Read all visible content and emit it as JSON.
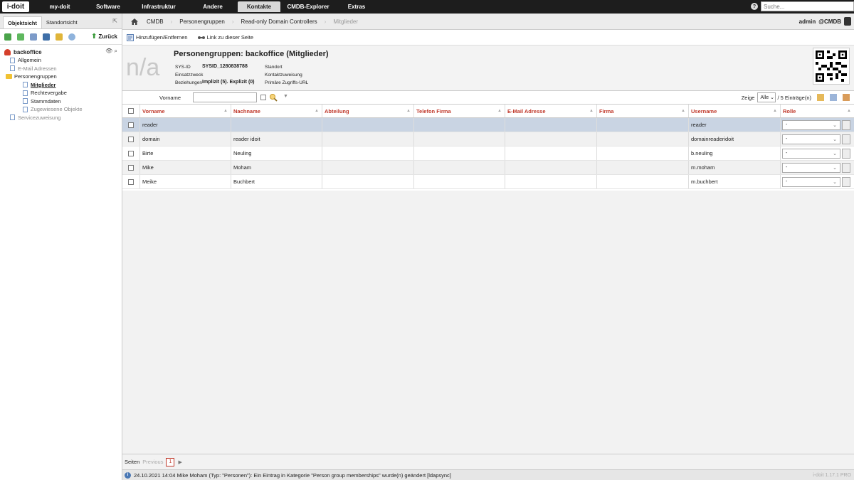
{
  "app": {
    "logo": "i-doit"
  },
  "nav": {
    "items": [
      "my-doit",
      "Software",
      "Infrastruktur",
      "Andere",
      "Kontakte",
      "CMDB-Explorer",
      "Extras"
    ],
    "active": "Kontakte"
  },
  "search": {
    "placeholder": "Suche..."
  },
  "left_panel": {
    "tabs": [
      "Objektsicht",
      "Standortsicht"
    ],
    "back_label": "Zurück",
    "root": "backoffice",
    "tree": [
      "Allgemein",
      "E-Mail Adressen",
      "Personengruppen",
      "Mitglieder",
      "Rechtevergabe",
      "Stammdaten",
      "Zugewiesene Objekte",
      "Servicezuweisung"
    ]
  },
  "breadcrumb": [
    "CMDB",
    "Personengruppen",
    "Read-only Domain Controllers",
    "Mitglieder"
  ],
  "user": {
    "name": "admin",
    "tenant": "@CMDB"
  },
  "actions": {
    "add_remove": "Hinzufügen/Entfernen",
    "link": "Link zu dieser Seite"
  },
  "object": {
    "placeholder_image": "n/a",
    "title": "Personengruppen: backoffice (Mitglieder)",
    "sysid_label": "SYS-ID",
    "sysid_value": "SYSID_1280838788",
    "purpose_label": "Einsatzzweck",
    "relations_label": "Beziehungen",
    "relations_value": "Implizit (5). Explizit (0)",
    "location_label": "Standort",
    "contact_label": "Kontaktzuweisung",
    "url_label": "Primäre Zugriffs-URL",
    "url_value": "-"
  },
  "filter": {
    "label": "Vorname",
    "show_label": "Zeige",
    "show_value": "Alle",
    "entries_text": "/ 5 Einträge(n)"
  },
  "table": {
    "columns": [
      "Vorname",
      "Nachname",
      "Abteilung",
      "Telefon Firma",
      "E-Mail Adresse",
      "Firma",
      "Username",
      "Rolle"
    ],
    "rows": [
      {
        "vorname": "reader",
        "nachname": "",
        "username": "reader",
        "rolle": "-"
      },
      {
        "vorname": "domain",
        "nachname": "reader idoit",
        "username": "domainreaderidoit",
        "rolle": "-"
      },
      {
        "vorname": "Birte",
        "nachname": "Neuling",
        "username": "b.neuling",
        "rolle": "-"
      },
      {
        "vorname": "Mike",
        "nachname": "Moham",
        "username": "m.moham",
        "rolle": "-"
      },
      {
        "vorname": "Meike",
        "nachname": "Buchbert",
        "username": "m.buchbert",
        "rolle": "-"
      }
    ]
  },
  "pager": {
    "label": "Seiten",
    "previous": "Previous",
    "current": "1"
  },
  "status": {
    "message": "24.10.2021 14:04 Mike Moham (Typ: \"Personen\"): Ein Eintrag in Kategorie \"Person group memberships\" wurde(n) geändert [ldapsync]",
    "version": "i-doit 1.17.1 PRO"
  },
  "colors": {
    "accent": "#c0392b",
    "nav_bg": "#1d1d1d",
    "selected_row": "#c9d4e3"
  }
}
